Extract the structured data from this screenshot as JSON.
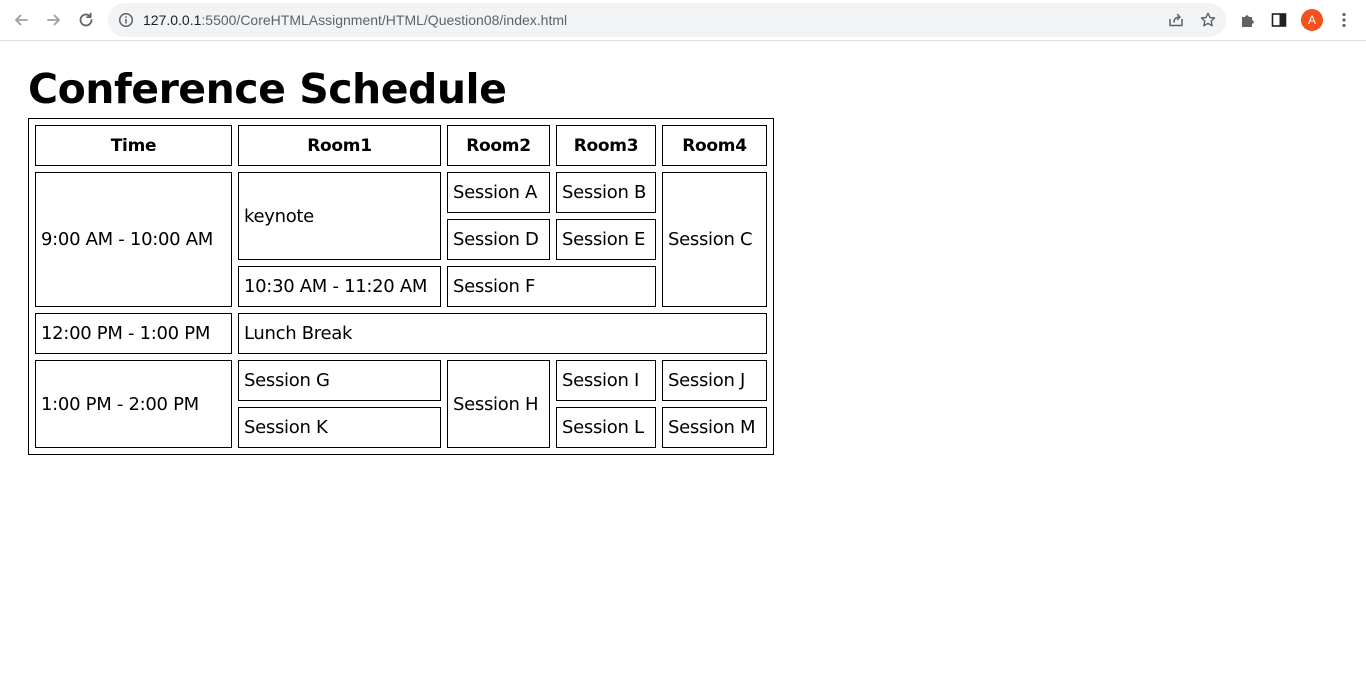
{
  "browser": {
    "url_host": "127.0.0.1",
    "url_path": ":5500/CoreHTMLAssignment/HTML/Question08/index.html",
    "avatar_letter": "A",
    "icons": [
      "back-icon",
      "forward-icon",
      "reload-icon",
      "info-icon",
      "share-icon",
      "star-icon",
      "extensions-icon",
      "side-panel-icon",
      "more-icon"
    ],
    "avatar_color": "#f4511e"
  },
  "page": {
    "title": "Conference Schedule"
  },
  "schedule": {
    "headers": {
      "time": "Time",
      "room1": "Room1",
      "room2": "Room2",
      "room3": "Room3",
      "room4": "Room4"
    },
    "rows": {
      "morning_time": "9:00 AM - 10:00 AM",
      "keynote": "keynote",
      "session_a": "Session A",
      "session_b": "Session B",
      "session_c": "Session C",
      "session_d": "Session D",
      "session_e": "Session E",
      "late_morning_time": "10:30 AM - 11:20 AM",
      "session_f": "Session F",
      "lunch_time": "12:00 PM - 1:00 PM",
      "lunch_break": "Lunch Break",
      "afternoon_time": "1:00 PM - 2:00 PM",
      "session_g": "Session G",
      "session_h": "Session H",
      "session_i": "Session I",
      "session_j": "Session J",
      "session_k": "Session K",
      "session_l": "Session L",
      "session_m": "Session M"
    }
  }
}
